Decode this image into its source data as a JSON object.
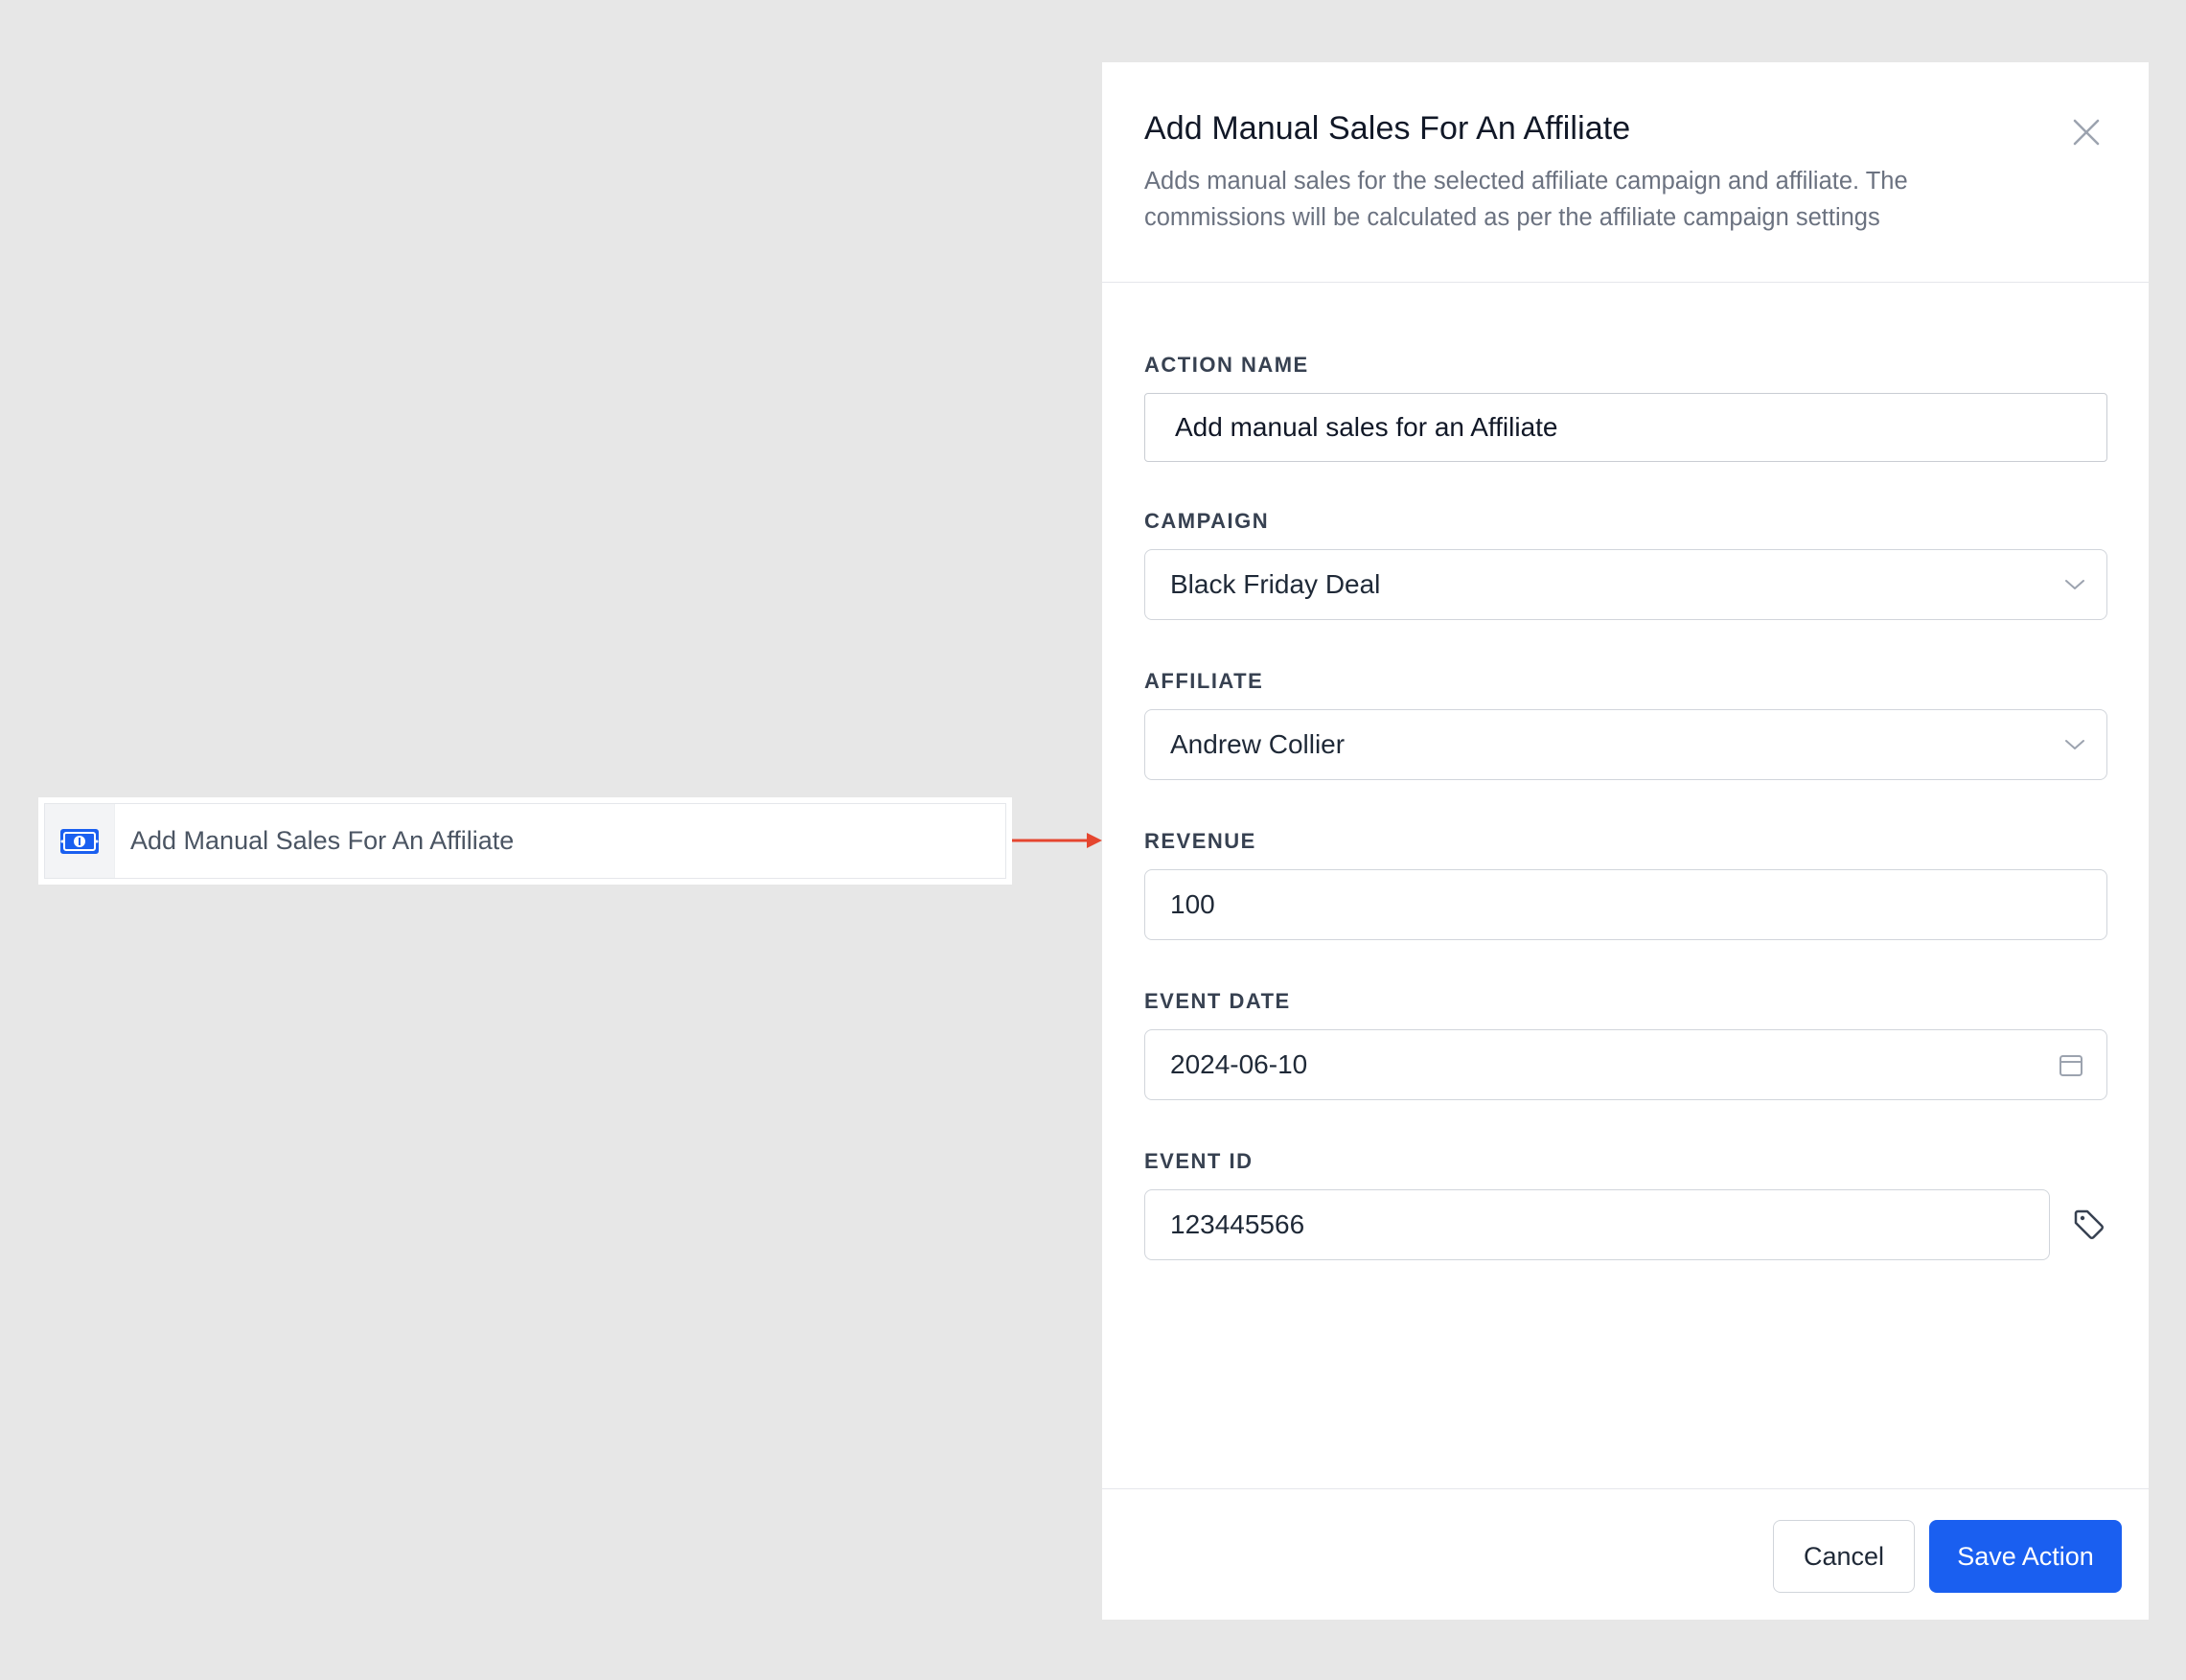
{
  "action_item": {
    "icon": "money-bill-icon",
    "label": "Add Manual Sales For An Affiliate"
  },
  "drawer": {
    "title": "Add Manual Sales For An Affiliate",
    "description": "Adds manual sales for the selected affiliate campaign and affiliate. The commissions will be calculated as per the affiliate campaign settings",
    "close_icon": "close-icon",
    "fields": {
      "action_name": {
        "label": "ACTION NAME",
        "value": "Add manual sales for an Affiliate"
      },
      "campaign": {
        "label": "CAMPAIGN",
        "value": "Black Friday Deal"
      },
      "affiliate": {
        "label": "AFFILIATE",
        "value": "Andrew Collier"
      },
      "revenue": {
        "label": "REVENUE",
        "value": "100"
      },
      "event_date": {
        "label": "EVENT DATE",
        "value": "2024-06-10",
        "icon": "calendar-icon"
      },
      "event_id": {
        "label": "EVENT ID",
        "value": "123445566",
        "icon": "tag-icon"
      }
    },
    "footer": {
      "cancel_label": "Cancel",
      "save_label": "Save Action"
    }
  },
  "colors": {
    "accent": "#1a5ff0",
    "arrow": "#e5462f",
    "background": "#e7e7e7"
  }
}
